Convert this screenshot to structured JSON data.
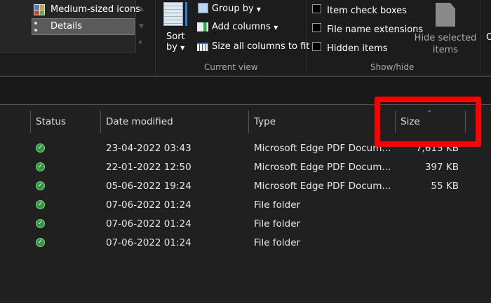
{
  "ribbon": {
    "layout": {
      "medium_icons": "Medium-sized icons",
      "details": "Details"
    },
    "current_view": {
      "sort_by_line1": "Sort",
      "sort_by_line2": "by",
      "group_by": "Group by",
      "add_columns": "Add columns",
      "size_all": "Size all columns to fit",
      "label": "Current view"
    },
    "show_hide": {
      "item_check_boxes": "Item check boxes",
      "file_name_extensions": "File name extensions",
      "hidden_items": "Hidden items",
      "hide_selected_line1": "Hide selected",
      "hide_selected_line2": "items",
      "label": "Show/hide",
      "options_partial": "O"
    }
  },
  "columns": {
    "status": "Status",
    "date_modified": "Date modified",
    "type": "Type",
    "size": "Size"
  },
  "rows": [
    {
      "date": "23-04-2022 03:43",
      "type": "Microsoft Edge PDF Docum...",
      "size": "7,615 KB"
    },
    {
      "date": "22-01-2022 12:50",
      "type": "Microsoft Edge PDF Docum...",
      "size": "397 KB"
    },
    {
      "date": "05-06-2022 19:24",
      "type": "Microsoft Edge PDF Docum...",
      "size": "55 KB"
    },
    {
      "date": "07-06-2022 01:24",
      "type": "File folder",
      "size": ""
    },
    {
      "date": "07-06-2022 01:24",
      "type": "File folder",
      "size": ""
    },
    {
      "date": "07-06-2022 01:24",
      "type": "File folder",
      "size": ""
    }
  ],
  "colors": {
    "highlight": "#ff0000",
    "synced": "#2e9a3e"
  }
}
